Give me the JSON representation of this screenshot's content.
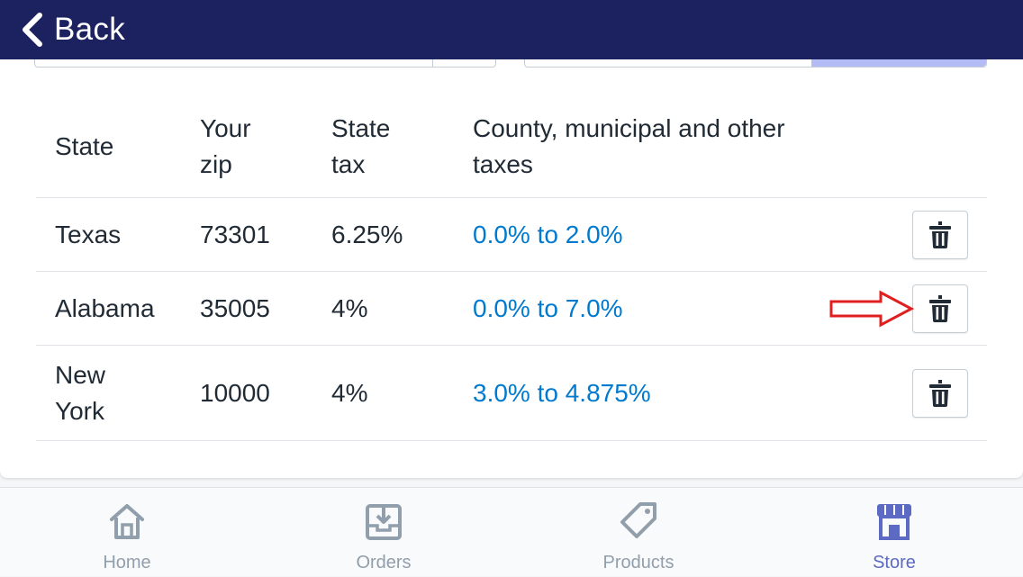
{
  "header": {
    "back_label": "Back"
  },
  "table": {
    "headers": {
      "state": "State",
      "zip_line1": "Your",
      "zip_line2": "zip",
      "tax_line1": "State",
      "tax_line2": "tax",
      "other_line1": "County, municipal and other",
      "other_line2": "taxes"
    },
    "rows": [
      {
        "state": "Texas",
        "zip": "73301",
        "state_tax": "6.25%",
        "other": "0.0% to 2.0%"
      },
      {
        "state": "Alabama",
        "zip": "35005",
        "state_tax": "4%",
        "other": "0.0% to 7.0%"
      },
      {
        "state_line1": "New",
        "state_line2": "York",
        "zip": "10000",
        "state_tax": "4%",
        "other": "3.0% to 4.875%"
      }
    ]
  },
  "tabs": [
    {
      "label": "Home",
      "icon": "home-icon"
    },
    {
      "label": "Orders",
      "icon": "orders-icon"
    },
    {
      "label": "Products",
      "icon": "tag-icon"
    },
    {
      "label": "Store",
      "icon": "store-icon",
      "active": true
    }
  ],
  "colors": {
    "header_bg": "#1c2260",
    "link": "#007ace",
    "active_tab": "#5c6ac4",
    "inactive_tab": "#919eab",
    "annotation_arrow": "#e02020"
  }
}
